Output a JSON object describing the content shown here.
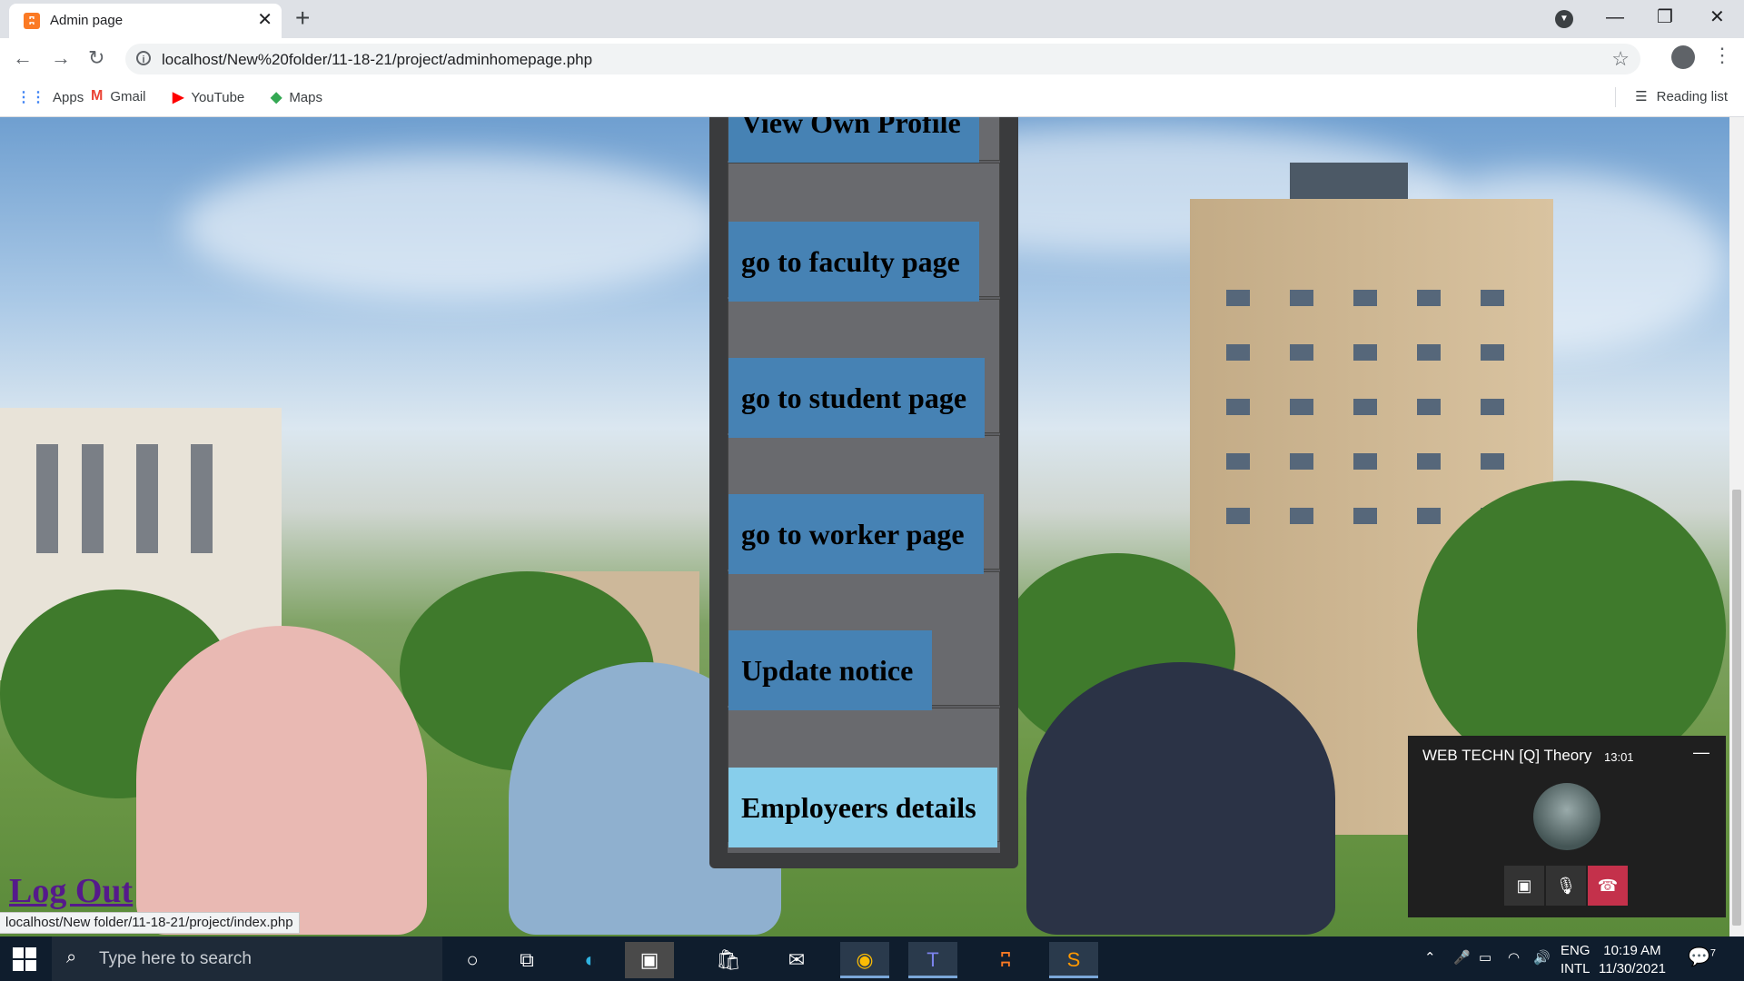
{
  "browser": {
    "tab_title": "Admin page",
    "url": "localhost/New%20folder/11-18-21/project/adminhomepage.php",
    "bookmarks": [
      "Apps",
      "Gmail",
      "YouTube",
      "Maps"
    ],
    "reading_list": "Reading list"
  },
  "menu": {
    "items": [
      "View Own Profile",
      "go to faculty page",
      "go to student page",
      "go to worker page",
      "Update notice",
      "Employeers details"
    ]
  },
  "logout_label": "Log Out",
  "status_url": "localhost/New folder/11-18-21/project/index.php",
  "teams": {
    "title": "WEB TECHN [Q] Theory",
    "time": "13:01"
  },
  "taskbar": {
    "search_placeholder": "Type here to search",
    "lang": "ENG",
    "lang2": "INTL",
    "time": "10:19 AM",
    "date": "11/30/2021",
    "notifications": "7"
  }
}
